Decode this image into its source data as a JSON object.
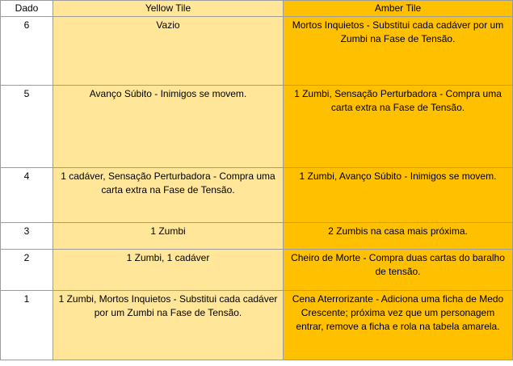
{
  "table": {
    "headers": {
      "dado": "Dado",
      "yellow": "Yellow Tile",
      "amber": "Amber Tile"
    },
    "rows": [
      {
        "dado": "6",
        "yellow": "Vazio",
        "amber": "Mortos Inquietos - Substitui cada cadáver por um Zumbi na Fase de Tensão."
      },
      {
        "dado": "5",
        "yellow": "Avanço Súbito - Inimigos se movem.",
        "amber": "1 Zumbi, Sensação Perturbadora - Compra uma carta extra na Fase de Tensão."
      },
      {
        "dado": "4",
        "yellow": "1 cadáver, Sensação Perturbadora - Compra uma carta extra na Fase de Tensão.",
        "amber": "1 Zumbi, Avanço Súbito - Inimigos se movem."
      },
      {
        "dado": "3",
        "yellow": "1 Zumbi",
        "amber": "2 Zumbis na casa mais próxima."
      },
      {
        "dado": "2",
        "yellow": "1 Zumbi, 1 cadáver",
        "amber": "Cheiro de Morte - Compra duas cartas do baralho de tensão."
      },
      {
        "dado": "1",
        "yellow": "1 Zumbi, Mortos Inquietos - Substitui cada cadáver por um Zumbi na Fase de Tensão.",
        "amber": "Cena Aterrorizante - Adiciona uma ficha de Medo Crescente; próxima vez que um personagem entrar, remove a ficha e rola na tabela amarela."
      }
    ]
  },
  "colors": {
    "yellow_tile": "#ffe699",
    "amber_tile": "#ffc000",
    "grid_line": "#9c9c9c"
  }
}
